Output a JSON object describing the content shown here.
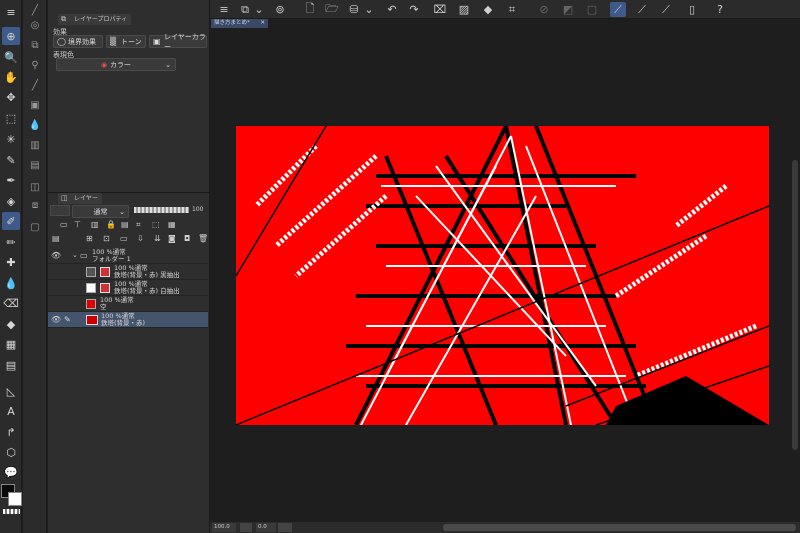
{
  "panels": {
    "layer_property": {
      "tab_label": "レイヤープロパティ",
      "effect_label": "効果",
      "border_effect_label": "境界効果",
      "tone_label": "トーン",
      "layer_color_label": "レイヤーカラー",
      "expression_color_label": "表現色",
      "expression_color_value": "カラー"
    },
    "layer": {
      "tab_label": "レイヤー",
      "blend_mode": "通常",
      "opacity": "100",
      "layers": [
        {
          "line1": "100 %通常",
          "line2": "フォルダー 1",
          "type": "folder"
        },
        {
          "line1": "100 %通常",
          "line2": "鉄塔(背景・赤)  黒抽出",
          "type": "layer"
        },
        {
          "line1": "100 %通常",
          "line2": "鉄塔(背景・赤)  白抽出",
          "type": "layer"
        },
        {
          "line1": "100 %通常",
          "line2": "空",
          "type": "layer"
        },
        {
          "line1": "100 %通常",
          "line2": "鉄塔(背景・赤)",
          "type": "layer",
          "selected": true
        }
      ]
    }
  },
  "canvas": {
    "tab_title": "描き方まとめ*",
    "background_color": "#ff0000"
  },
  "status": {
    "zoom": "100.0",
    "rotation": "0.0"
  },
  "colors": {
    "accent": "#3d5a8a",
    "canvas_red": "#ff0000",
    "main_color": "#0a0a0a",
    "sub_color": "#ffffff"
  }
}
